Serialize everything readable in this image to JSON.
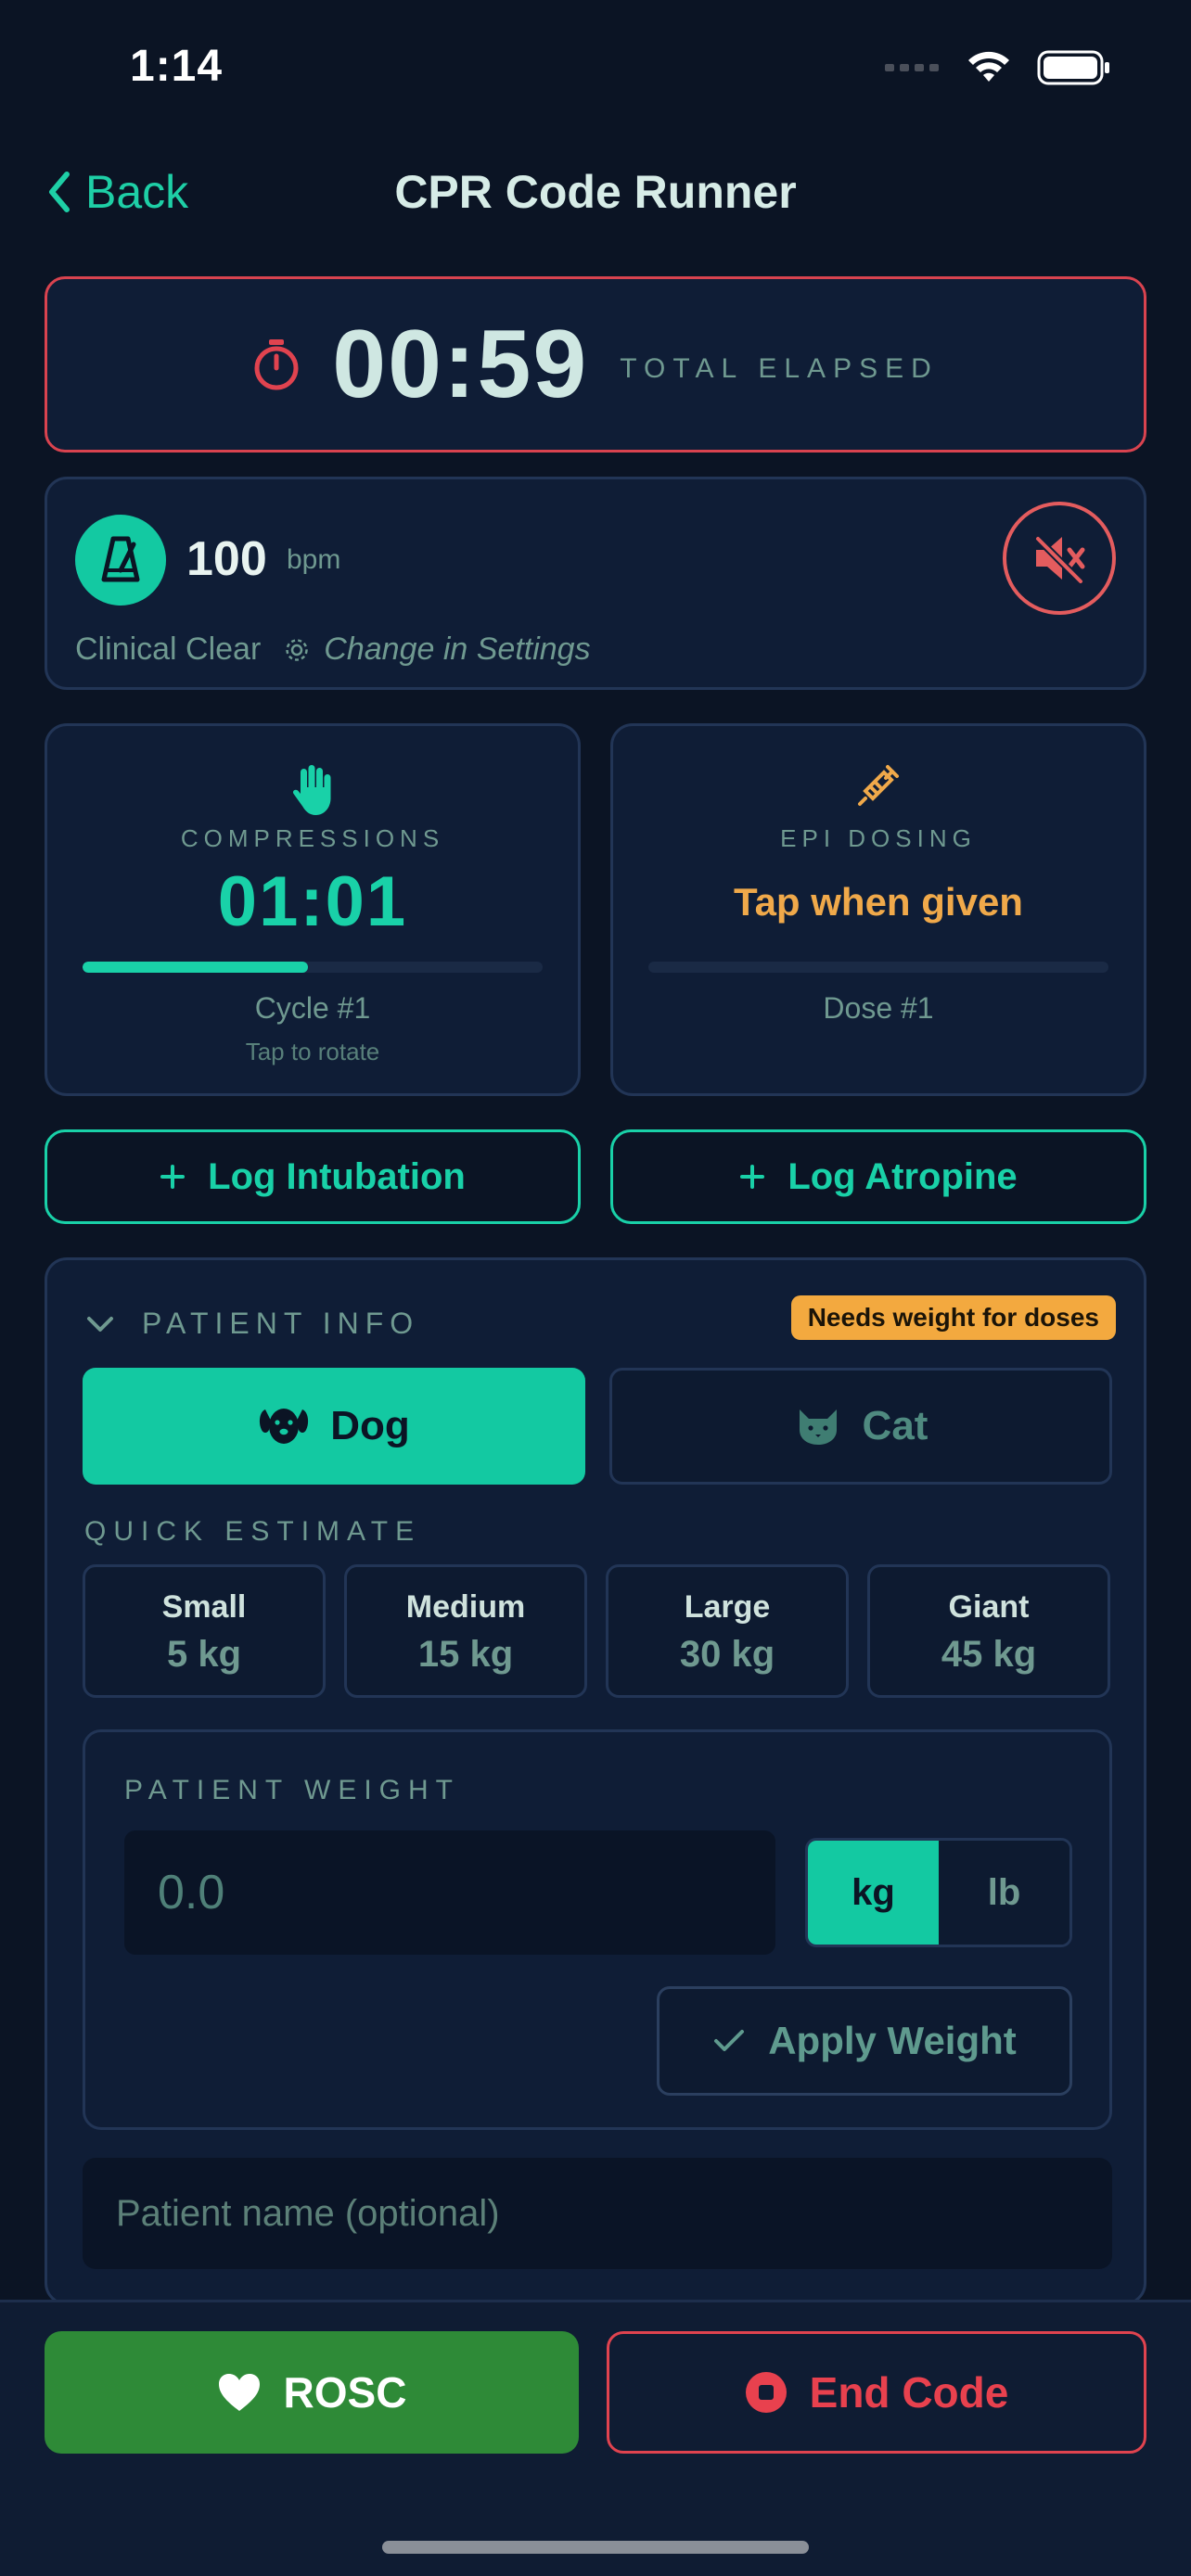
{
  "status_bar": {
    "time": "1:14"
  },
  "nav": {
    "back_label": "Back",
    "title": "CPR Code Runner"
  },
  "elapsed": {
    "time": "00:59",
    "label": "TOTAL ELAPSED"
  },
  "metronome": {
    "bpm": "100",
    "unit": "bpm",
    "sound_profile": "Clinical Clear",
    "settings_hint": "Change in Settings",
    "muted": true
  },
  "compressions": {
    "label": "COMPRESSIONS",
    "timer": "01:01",
    "progress": 0.49,
    "cycle": "Cycle #1",
    "hint": "Tap to rotate"
  },
  "epi": {
    "label": "EPI DOSING",
    "status": "Tap when given",
    "progress": 0,
    "dose": "Dose #1"
  },
  "actions": {
    "log_intubation": "Log Intubation",
    "log_atropine": "Log Atropine"
  },
  "patient_info": {
    "header": "PATIENT INFO",
    "badge": "Needs weight for doses",
    "species": {
      "dog": "Dog",
      "cat": "Cat",
      "selected": "Dog"
    },
    "quick_estimate_label": "QUICK ESTIMATE",
    "quick_estimates": [
      {
        "name": "Small",
        "weight": "5 kg"
      },
      {
        "name": "Medium",
        "weight": "15 kg"
      },
      {
        "name": "Large",
        "weight": "30 kg"
      },
      {
        "name": "Giant",
        "weight": "45 kg"
      }
    ],
    "weight_label": "PATIENT WEIGHT",
    "weight_placeholder": "0.0",
    "units": {
      "kg": "kg",
      "lb": "lb",
      "selected": "kg"
    },
    "apply_label": "Apply Weight",
    "name_placeholder": "Patient name (optional)"
  },
  "bottom": {
    "rosc_label": "ROSC",
    "end_label": "End Code"
  },
  "colors": {
    "accent": "#13c9a2",
    "alert": "#e0434f",
    "warning": "#f3a93f",
    "success": "#2e8a37",
    "background": "#0b1424"
  }
}
